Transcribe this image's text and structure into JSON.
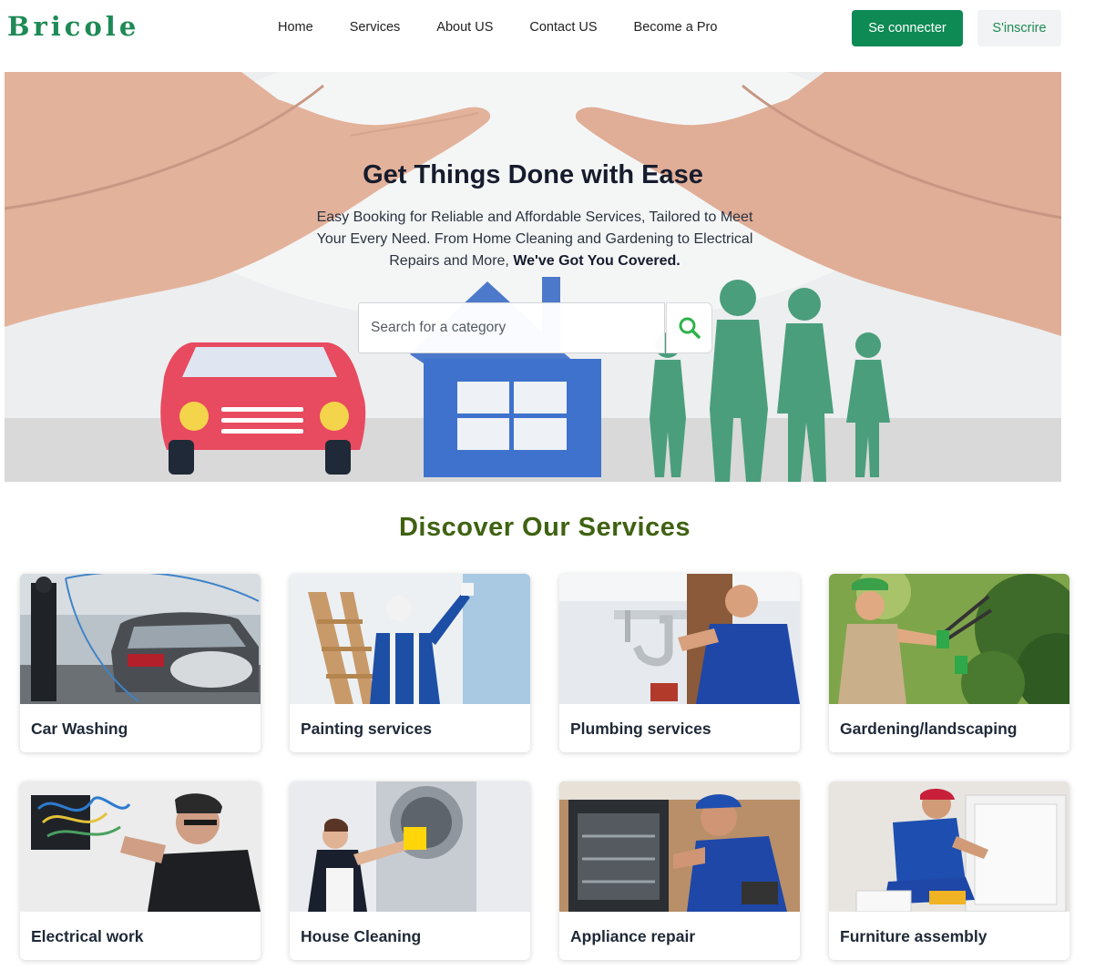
{
  "brand": {
    "logo": "Bricole"
  },
  "nav": {
    "links": [
      "Home",
      "Services",
      "About US",
      "Contact US",
      "Become a Pro"
    ],
    "login_label": "Se connecter",
    "signup_label": "S'inscrire"
  },
  "hero": {
    "title": "Get Things Done with Ease",
    "text": "Easy Booking for Reliable and Affordable Services, Tailored to Meet Your Every Need. From Home Cleaning and Gardening to Electrical Repairs and More,",
    "text_bold": "We've Got You Covered.",
    "search_placeholder": "Search for a category",
    "search_icon": "search-icon"
  },
  "services": {
    "title": "Discover Our Services",
    "items": [
      {
        "label": "Car Washing",
        "image": "car-washing-photo"
      },
      {
        "label": "Painting services",
        "image": "painting-photo"
      },
      {
        "label": "Plumbing services",
        "image": "plumbing-photo"
      },
      {
        "label": "Gardening/landscaping",
        "image": "gardening-photo"
      },
      {
        "label": "Electrical work",
        "image": "electrical-photo"
      },
      {
        "label": "House Cleaning",
        "image": "cleaning-photo"
      },
      {
        "label": "Appliance repair",
        "image": "appliance-photo"
      },
      {
        "label": "Furniture assembly",
        "image": "furniture-photo"
      }
    ]
  },
  "colors": {
    "brand_green": "#1e8a55",
    "button_green": "#0e8a55",
    "section_title": "#3f6212"
  }
}
